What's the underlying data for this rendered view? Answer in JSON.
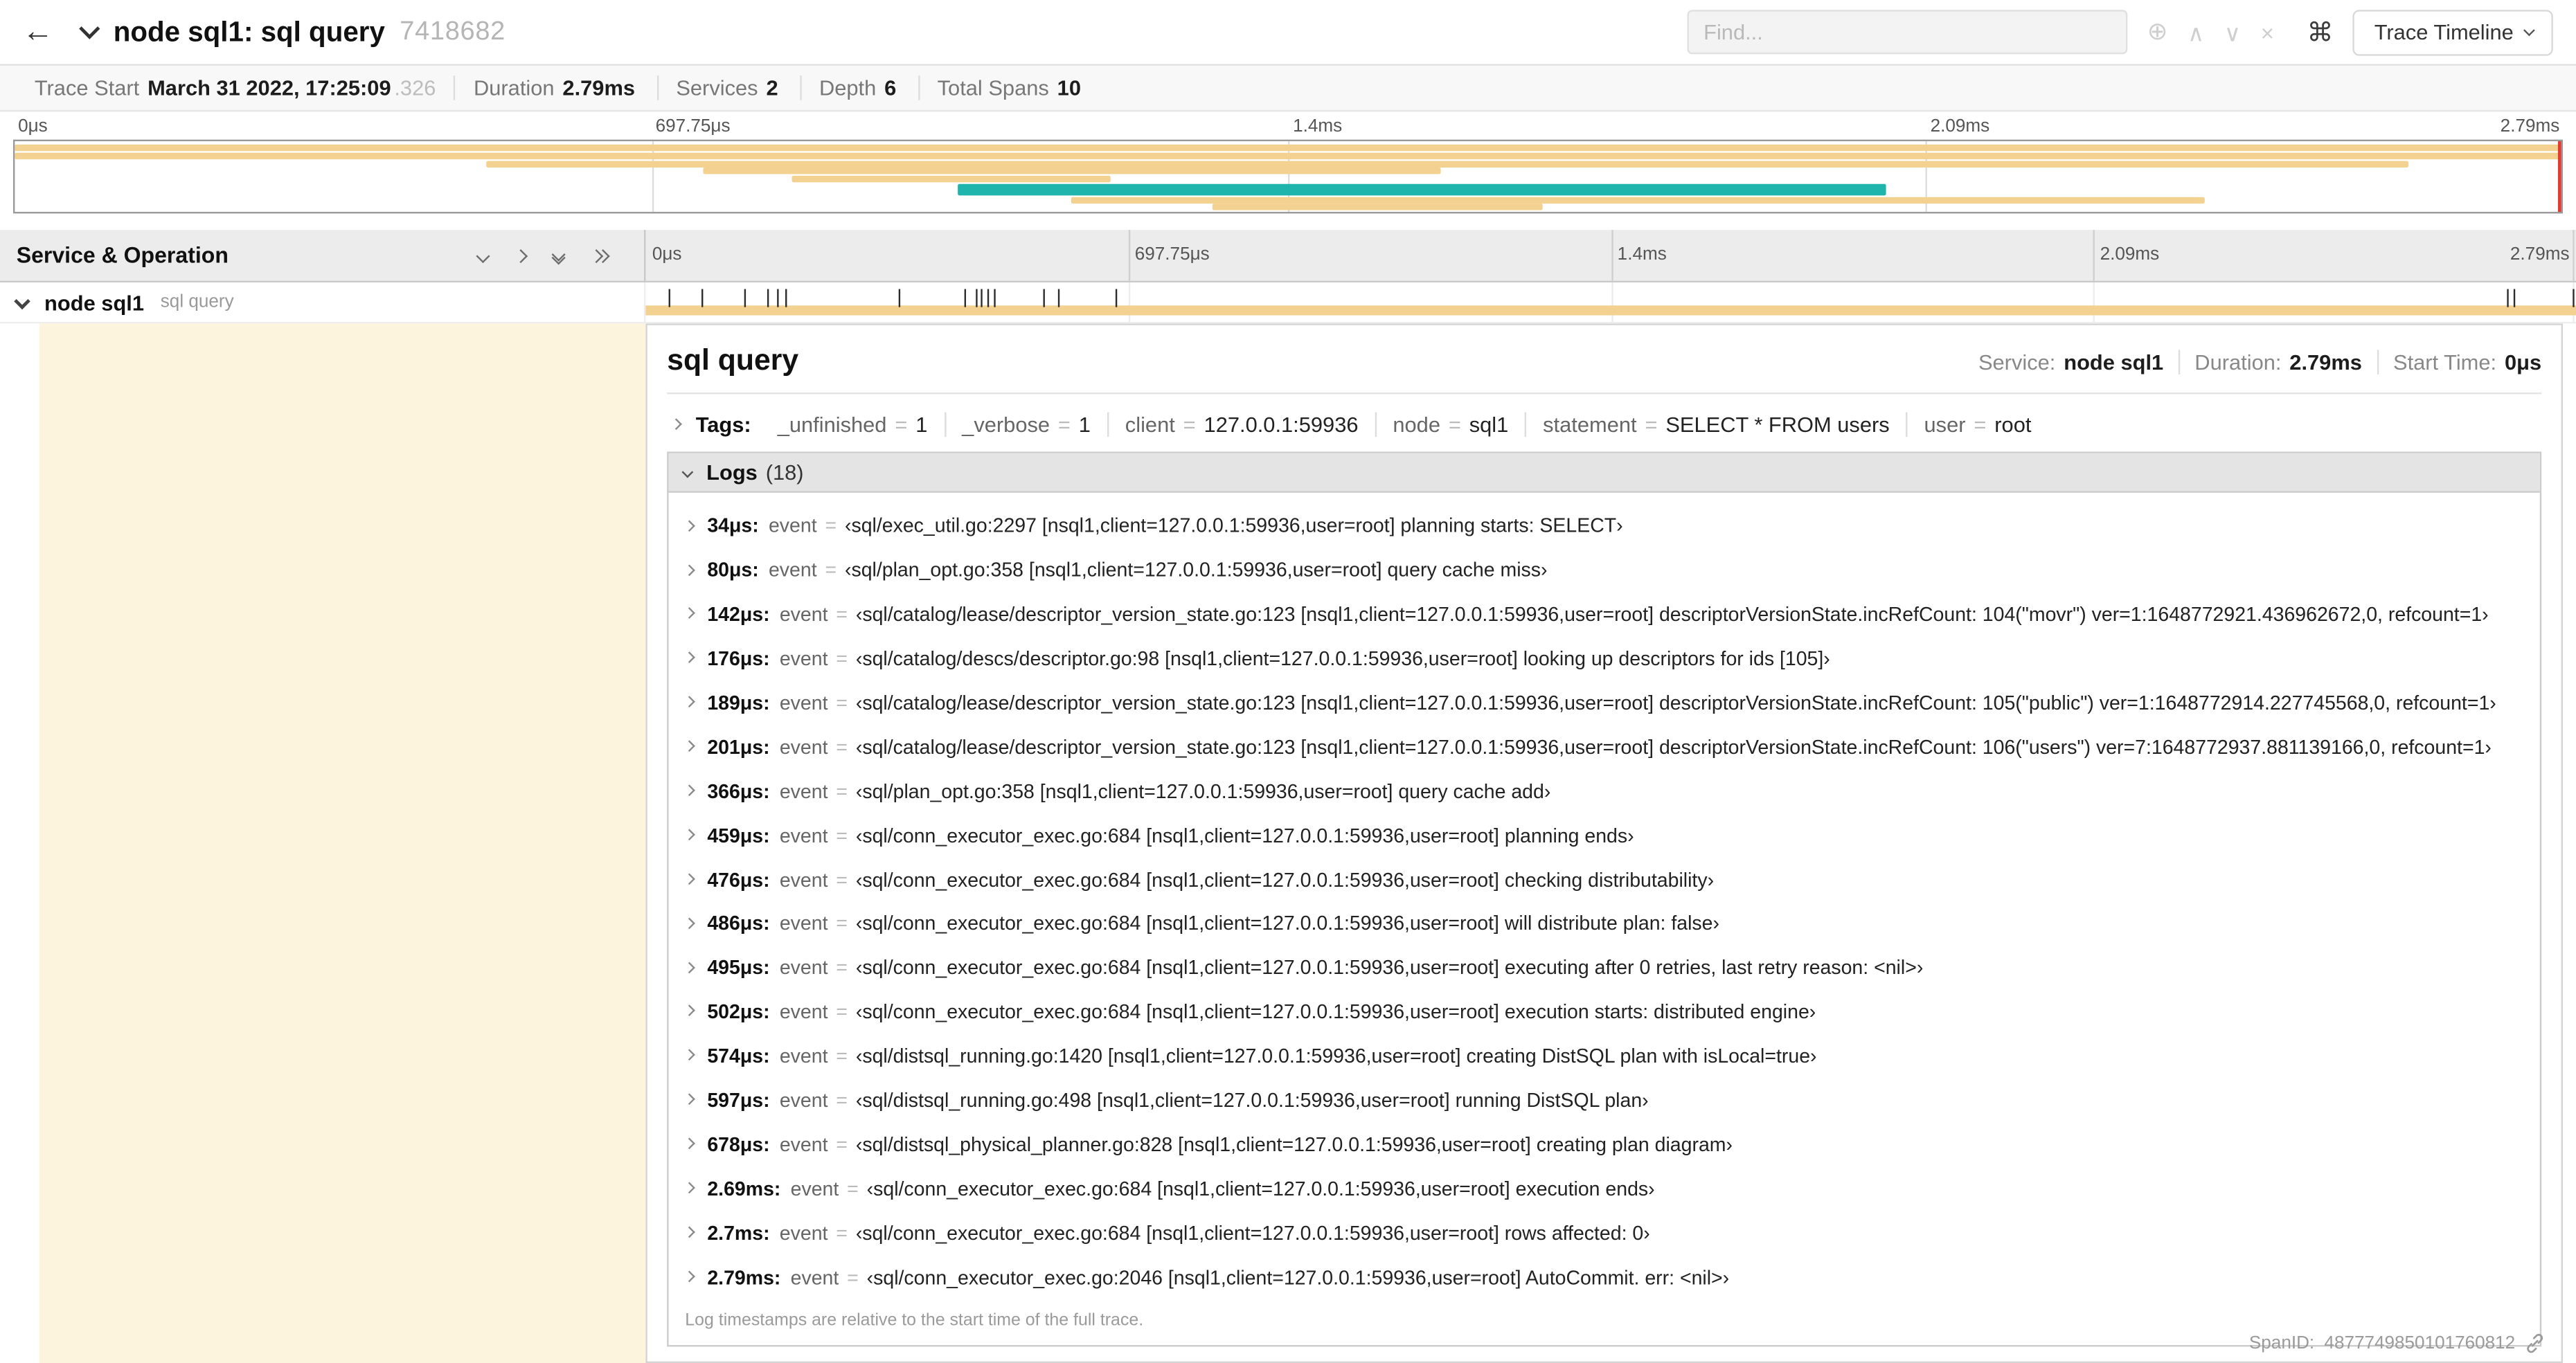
{
  "icons": {
    "back": "←",
    "command": "⌘",
    "find_zoom": "⊕",
    "find_prev": "∧",
    "find_next": "∨",
    "find_clear": "×"
  },
  "colors": {
    "span_tan": "#f3d191",
    "span_teal": "#1fb5ad",
    "marker_red": "#e23b32",
    "detail_cream": "#fcf4dd"
  },
  "header": {
    "title": "node sql1: sql query",
    "trace_id": "7418682",
    "find_placeholder": "Find...",
    "view_selector": "Trace Timeline"
  },
  "summary": {
    "items": [
      {
        "label": "Trace Start",
        "value": "March 31 2022, 17:25:09",
        "suffix": ".326"
      },
      {
        "label": "Duration",
        "value": "2.79ms"
      },
      {
        "label": "Services",
        "value": "2"
      },
      {
        "label": "Depth",
        "value": "6"
      },
      {
        "label": "Total Spans",
        "value": "10"
      }
    ]
  },
  "minimap": {
    "ticks": [
      {
        "label": "0μs",
        "pct": 0
      },
      {
        "label": "697.75μs",
        "pct": 25
      },
      {
        "label": "1.4ms",
        "pct": 50
      },
      {
        "label": "2.09ms",
        "pct": 75
      },
      {
        "label": "2.79ms",
        "pct": 100,
        "cls": "end"
      }
    ],
    "gridlines": [
      25,
      50,
      75
    ],
    "bars": [
      {
        "l": 0,
        "w": 100,
        "t": 2,
        "h": 4,
        "c": "#f3d191"
      },
      {
        "l": 0,
        "w": 100,
        "t": 7,
        "h": 4,
        "c": "#f3d191"
      },
      {
        "l": 18.5,
        "w": 75.5,
        "t": 12,
        "h": 4,
        "c": "#f3d191"
      },
      {
        "l": 27,
        "w": 29,
        "t": 16,
        "h": 4,
        "c": "#f3d191"
      },
      {
        "l": 30.5,
        "w": 12.5,
        "t": 21,
        "h": 4,
        "c": "#f3d191"
      },
      {
        "l": 37,
        "w": 36.5,
        "t": 26,
        "h": 7,
        "c": "#1fb5ad"
      },
      {
        "l": 41.5,
        "w": 44.5,
        "t": 34,
        "h": 4,
        "c": "#f3d191"
      },
      {
        "l": 47,
        "w": 13,
        "t": 38,
        "h": 4,
        "c": "#f3d191"
      }
    ]
  },
  "timeline": {
    "left_title": "Service & Operation",
    "ticks": [
      {
        "label": "0μs",
        "pct": 0
      },
      {
        "label": "697.75μs",
        "pct": 25
      },
      {
        "label": "1.4ms",
        "pct": 50
      },
      {
        "label": "2.09ms",
        "pct": 75
      },
      {
        "label": "2.79ms",
        "pct": 100,
        "cls": "end"
      }
    ],
    "gridlines": [
      25,
      50,
      75,
      99.85
    ]
  },
  "span_row": {
    "service": "node sql1",
    "operation": "sql query",
    "tick_positions_pct": [
      1.2,
      2.9,
      5.1,
      6.3,
      6.8,
      7.2,
      13.1,
      16.5,
      17.1,
      17.4,
      17.7,
      18.0,
      20.6,
      21.4,
      24.3,
      96.4,
      96.8,
      99.8
    ]
  },
  "detail": {
    "operation": "sql query",
    "eq": "=",
    "stats": [
      {
        "label": "Service:",
        "value": "node sql1"
      },
      {
        "label": "Duration:",
        "value": "2.79ms"
      },
      {
        "label": "Start Time:",
        "value": "0μs"
      }
    ],
    "tags_label": "Tags:",
    "tags": [
      {
        "key": "_unfinished",
        "value": "1"
      },
      {
        "key": "_verbose",
        "value": "1"
      },
      {
        "key": "client",
        "value": "127.0.0.1:59936"
      },
      {
        "key": "node",
        "value": "sql1"
      },
      {
        "key": "statement",
        "value": "SELECT * FROM users"
      },
      {
        "key": "user",
        "value": "root"
      }
    ],
    "logs_label": "Logs",
    "logs_count": "(18)",
    "log_field": "event",
    "logs": [
      {
        "time": "34μs:",
        "value": "‹sql/exec_util.go:2297 [nsql1,client=127.0.0.1:59936,user=root] planning starts: SELECT›"
      },
      {
        "time": "80μs:",
        "value": "‹sql/plan_opt.go:358 [nsql1,client=127.0.0.1:59936,user=root] query cache miss›"
      },
      {
        "time": "142μs:",
        "value": "‹sql/catalog/lease/descriptor_version_state.go:123 [nsql1,client=127.0.0.1:59936,user=root] descriptorVersionState.incRefCount: 104(\"movr\") ver=1:1648772921.436962672,0, refcount=1›"
      },
      {
        "time": "176μs:",
        "value": "‹sql/catalog/descs/descriptor.go:98 [nsql1,client=127.0.0.1:59936,user=root] looking up descriptors for ids [105]›"
      },
      {
        "time": "189μs:",
        "value": "‹sql/catalog/lease/descriptor_version_state.go:123 [nsql1,client=127.0.0.1:59936,user=root] descriptorVersionState.incRefCount: 105(\"public\") ver=1:1648772914.227745568,0, refcount=1›"
      },
      {
        "time": "201μs:",
        "value": "‹sql/catalog/lease/descriptor_version_state.go:123 [nsql1,client=127.0.0.1:59936,user=root] descriptorVersionState.incRefCount: 106(\"users\") ver=7:1648772937.881139166,0, refcount=1›"
      },
      {
        "time": "366μs:",
        "value": "‹sql/plan_opt.go:358 [nsql1,client=127.0.0.1:59936,user=root] query cache add›"
      },
      {
        "time": "459μs:",
        "value": "‹sql/conn_executor_exec.go:684 [nsql1,client=127.0.0.1:59936,user=root] planning ends›"
      },
      {
        "time": "476μs:",
        "value": "‹sql/conn_executor_exec.go:684 [nsql1,client=127.0.0.1:59936,user=root] checking distributability›"
      },
      {
        "time": "486μs:",
        "value": "‹sql/conn_executor_exec.go:684 [nsql1,client=127.0.0.1:59936,user=root] will distribute plan: false›"
      },
      {
        "time": "495μs:",
        "value": "‹sql/conn_executor_exec.go:684 [nsql1,client=127.0.0.1:59936,user=root] executing after 0 retries, last retry reason: <nil>›"
      },
      {
        "time": "502μs:",
        "value": "‹sql/conn_executor_exec.go:684 [nsql1,client=127.0.0.1:59936,user=root] execution starts: distributed engine›"
      },
      {
        "time": "574μs:",
        "value": "‹sql/distsql_running.go:1420 [nsql1,client=127.0.0.1:59936,user=root] creating DistSQL plan with isLocal=true›"
      },
      {
        "time": "597μs:",
        "value": "‹sql/distsql_running.go:498 [nsql1,client=127.0.0.1:59936,user=root] running DistSQL plan›"
      },
      {
        "time": "678μs:",
        "value": "‹sql/distsql_physical_planner.go:828 [nsql1,client=127.0.0.1:59936,user=root] creating plan diagram›"
      },
      {
        "time": "2.69ms:",
        "value": "‹sql/conn_executor_exec.go:684 [nsql1,client=127.0.0.1:59936,user=root] execution ends›"
      },
      {
        "time": "2.7ms:",
        "value": "‹sql/conn_executor_exec.go:684 [nsql1,client=127.0.0.1:59936,user=root] rows affected: 0›"
      },
      {
        "time": "2.79ms:",
        "value": "‹sql/conn_executor_exec.go:2046 [nsql1,client=127.0.0.1:59936,user=root] AutoCommit. err: <nil>›"
      }
    ],
    "footer_note": "Log timestamps are relative to the start time of the full trace.",
    "span_id_label": "SpanID:",
    "span_id": "4877749850101760812"
  }
}
